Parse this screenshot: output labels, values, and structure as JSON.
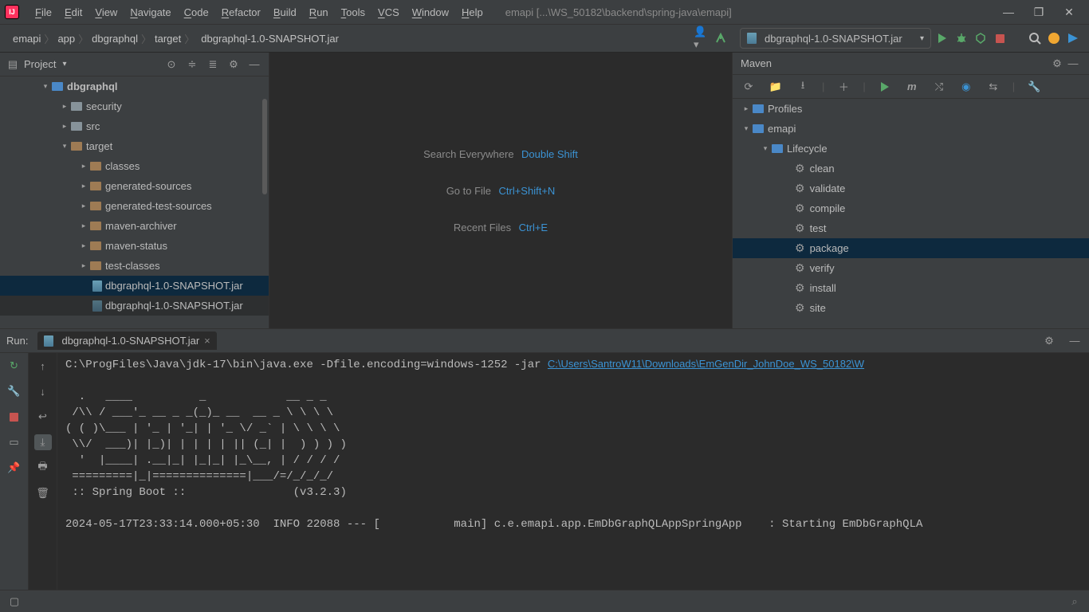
{
  "menus": [
    "File",
    "Edit",
    "View",
    "Navigate",
    "Code",
    "Refactor",
    "Build",
    "Run",
    "Tools",
    "VCS",
    "Window",
    "Help"
  ],
  "window_title": "emapi [...\\WS_50182\\backend\\spring-java\\emapi]",
  "breadcrumbs": [
    "emapi",
    "app",
    "dbgraphql",
    "target",
    "dbgraphql-1.0-SNAPSHOT.jar"
  ],
  "run_config": "dbgraphql-1.0-SNAPSHOT.jar",
  "project_label": "Project",
  "tree": {
    "dbgraphql": "dbgraphql",
    "security": "security",
    "src": "src",
    "target": "target",
    "classes": "classes",
    "generated_sources": "generated-sources",
    "generated_test_sources": "generated-test-sources",
    "maven_archiver": "maven-archiver",
    "maven_status": "maven-status",
    "test_classes": "test-classes",
    "jar1": "dbgraphql-1.0-SNAPSHOT.jar",
    "jar2": "dbgraphql-1.0-SNAPSHOT.jar"
  },
  "tips": {
    "search": "Search Everywhere",
    "search_kbd": "Double Shift",
    "goto": "Go to File",
    "goto_kbd": "Ctrl+Shift+N",
    "recent": "Recent Files",
    "recent_kbd": "Ctrl+E"
  },
  "maven": {
    "title": "Maven",
    "profiles": "Profiles",
    "emapi": "emapi",
    "lifecycle": "Lifecycle",
    "phases": [
      "clean",
      "validate",
      "compile",
      "test",
      "package",
      "verify",
      "install",
      "site"
    ],
    "selected": "package"
  },
  "run": {
    "label": "Run:",
    "tab": "dbgraphql-1.0-SNAPSHOT.jar",
    "cmd_pre": "C:\\ProgFiles\\Java\\jdk-17\\bin\\java.exe -Dfile.encoding=windows-1252 -jar ",
    "cmd_link": "C:\\Users\\SantroW11\\Downloads\\EmGenDir_JohnDoe_WS_50182\\W",
    "ascii": "  .   ____          _            __ _ _\n /\\\\ / ___'_ __ _ _(_)_ __  __ _ \\ \\ \\ \\\n( ( )\\___ | '_ | '_| | '_ \\/ _` | \\ \\ \\ \\\n \\\\/  ___)| |_)| | | | | || (_| |  ) ) ) )\n  '  |____| .__|_| |_|_| |_\\__, | / / / /\n =========|_|==============|___/=/_/_/_/\n :: Spring Boot ::                (v3.2.3)\n\n2024-05-17T23:33:14.000+05:30  INFO 22088 --- [           main] c.e.emapi.app.EmDbGraphQLAppSpringApp    : Starting EmDbGraphQLA"
  }
}
